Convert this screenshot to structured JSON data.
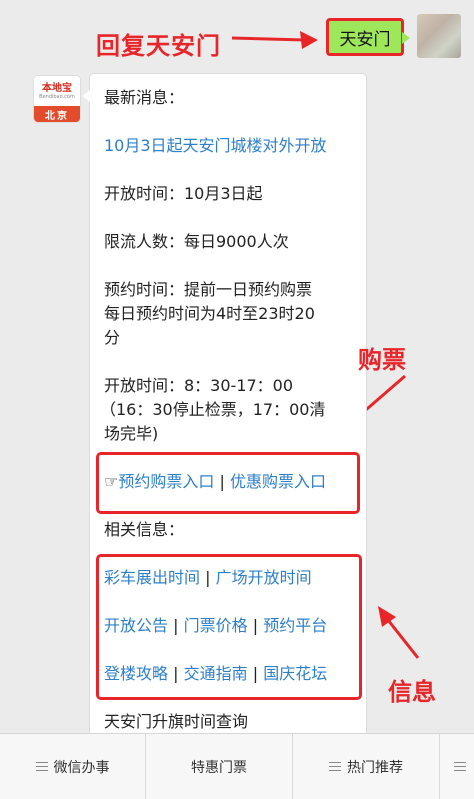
{
  "annotations": {
    "reply_label": "回复天安门",
    "buy_label": "购票",
    "info_label": "信息"
  },
  "user_message": "天安门",
  "bot": {
    "avatar_title": "本地宝",
    "avatar_site": "Bendibao.com",
    "avatar_city": "北京",
    "lines": {
      "latest": "最新消息：",
      "headline": "10月3日起天安门城楼对外开放",
      "open_date": "开放时间：10月3日起",
      "limit": "限流人数：每日9000人次",
      "reserve_1": "预约时间：提前一日预约购票",
      "reserve_2": "每日预约时间为4时至23时20",
      "reserve_3": "分",
      "hours_1": "开放时间：8：30-17：00",
      "hours_2": "（16：30停止检票，17：00清",
      "hours_3": "场完毕)",
      "related": "相关信息：",
      "bottom": "天安门升旗时间查询"
    },
    "ticket_links": {
      "icon": "☞",
      "reserve": "预约购票入口",
      "discount": "优惠购票入口",
      "sep": "|"
    },
    "info_links": [
      [
        "彩车展出时间",
        "广场开放时间"
      ],
      [
        "开放公告",
        "门票价格",
        "预约平台"
      ],
      [
        "登楼攻略",
        "交通指南",
        "国庆花坛"
      ]
    ]
  },
  "menu": [
    {
      "label": "微信办事",
      "icon": "menu-icon"
    },
    {
      "label": "特惠门票",
      "icon": ""
    },
    {
      "label": "热门推荐",
      "icon": "menu-icon"
    },
    {
      "label": "",
      "icon": "menu-icon"
    }
  ],
  "colors": {
    "accent_red": "#e8262a",
    "link_blue": "#2e7fca",
    "bubble_green": "#9fe75a"
  }
}
